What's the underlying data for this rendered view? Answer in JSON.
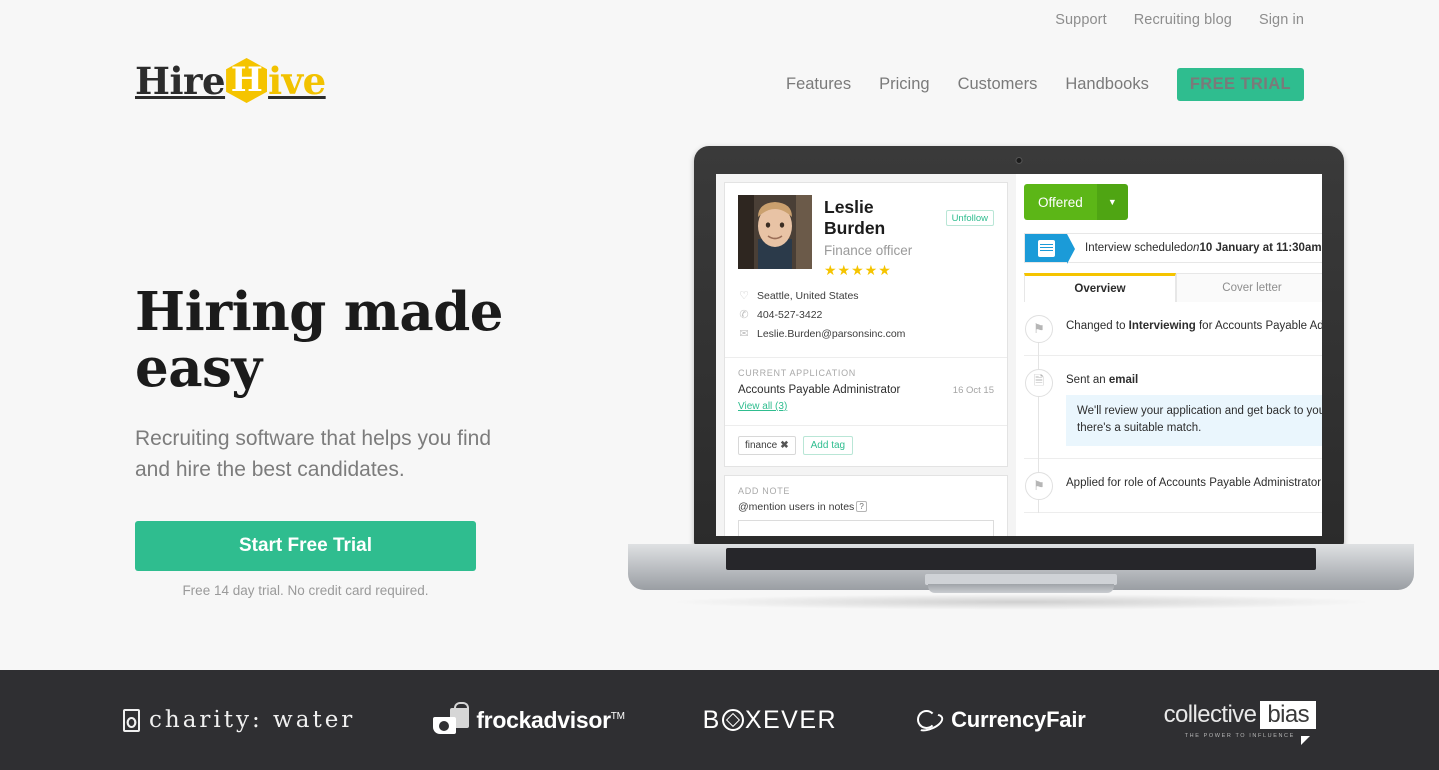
{
  "topbar": {
    "links": [
      {
        "label": "Support"
      },
      {
        "label": "Recruiting blog"
      },
      {
        "label": "Sign in"
      }
    ]
  },
  "header": {
    "logo": {
      "lead": "Hire",
      "hex_letter": "H",
      "tail": "ive"
    },
    "nav": [
      {
        "label": "Features"
      },
      {
        "label": "Pricing"
      },
      {
        "label": "Customers"
      },
      {
        "label": "Handbooks"
      }
    ],
    "cta_label": "FREE TRIAL",
    "cta_color": "#2fbd8f"
  },
  "hero": {
    "title": "Hiring made easy",
    "subtitle": "Recruiting software that helps you find and hire the best candidates.",
    "button_label": "Start Free Trial",
    "button_note": "Free 14 day trial. No credit card required.",
    "button_color": "#2fbd8f"
  },
  "app": {
    "candidate": {
      "name": "Leslie Burden",
      "follow_badge": "Unfollow",
      "job_title": "Finance officer",
      "rating_stars": "★★★★★",
      "rating_value": 5,
      "location": "Seattle, United States",
      "phone": "404-527-3422",
      "email": "Leslie.Burden@parsonsinc.com"
    },
    "current_application": {
      "section_label": "CURRENT APPLICATION",
      "role": "Accounts Payable Administrator",
      "date": "16 Oct 15",
      "view_all": "View all (3)"
    },
    "tags": {
      "items": [
        {
          "label": "finance",
          "remove": "✖"
        }
      ],
      "add_label": "Add tag"
    },
    "note": {
      "section_label": "ADD NOTE",
      "hint": "@mention users in notes",
      "help_glyph": "?"
    },
    "status": {
      "label": "Offered",
      "caret": "▼",
      "color": "#5cb617"
    },
    "banner": {
      "text_prefix": "Interview scheduled ",
      "text_em": "on ",
      "text_bold": "10 January at 11:30am",
      "color": "#1b9bd8"
    },
    "tabs": [
      {
        "label": "Overview",
        "active": true
      },
      {
        "label": "Cover letter",
        "active": false
      }
    ],
    "feed": [
      {
        "icon": "flag-icon",
        "text_before": "Changed to ",
        "text_bold": "Interviewing",
        "text_after": " for Accounts Payable Ad",
        "quote": null
      },
      {
        "icon": "document-icon",
        "text_before": "Sent an ",
        "text_bold": "email",
        "text_after": "",
        "quote": "We'll review your application and get back to you if there's a suitable match."
      },
      {
        "icon": "flag-icon",
        "text_before": "Applied for role of Accounts Payable Administrator",
        "text_bold": "",
        "text_after": "",
        "quote": null
      }
    ]
  },
  "footer": {
    "logos": [
      {
        "name": "charity: water",
        "text": "charity: water"
      },
      {
        "name": "frockadvisor",
        "text": "frockadvisor",
        "tm": "TM"
      },
      {
        "name": "Boxever",
        "text_left": "B",
        "text_right": "XEVER"
      },
      {
        "name": "CurrencyFair",
        "text": "CurrencyFair"
      },
      {
        "name": "collective bias",
        "text_left": "collective",
        "text_right": "bias",
        "tagline": "THE POWER TO INFLUENCE"
      }
    ],
    "background": "#2f2f32"
  }
}
